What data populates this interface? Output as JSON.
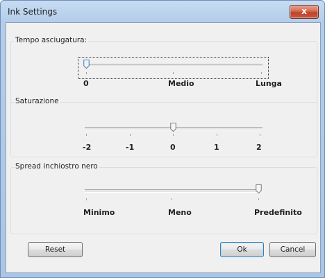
{
  "window": {
    "title": "Ink Settings",
    "close_label": "x"
  },
  "drying_time": {
    "label": "Tempo asciugatura:",
    "ticks": [
      "0",
      "Medio",
      "Lunga"
    ],
    "selected": "0"
  },
  "saturation": {
    "label": "Saturazione",
    "ticks": [
      "-2",
      "-1",
      "0",
      "1",
      "2"
    ],
    "selected": "0"
  },
  "black_spread": {
    "label": "Spread inchiostro nero",
    "ticks": [
      "Minimo",
      "Meno",
      "Predefinito"
    ],
    "selected": "Predefinito"
  },
  "buttons": {
    "reset": "Reset",
    "ok": "Ok",
    "cancel": "Cancel"
  },
  "colors": {
    "title_bar": "#b4cdea",
    "close_button": "#c0442a",
    "dialog_bg": "#f0f0f0"
  },
  "icons": {
    "close": "close-icon"
  }
}
